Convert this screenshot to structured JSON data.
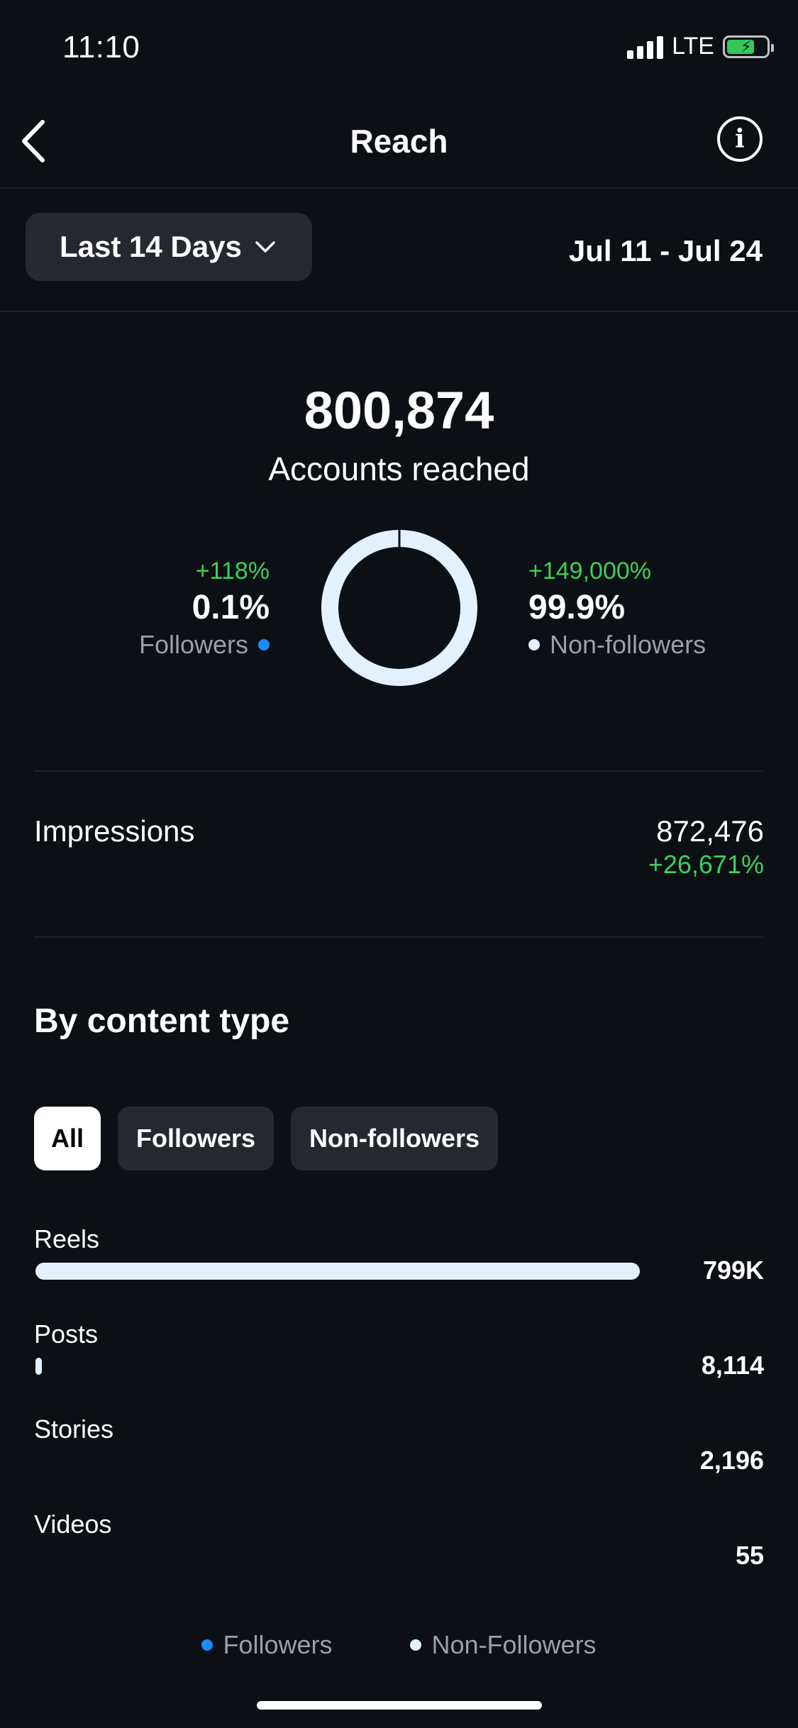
{
  "status_bar": {
    "time": "11:10",
    "network": "LTE"
  },
  "header": {
    "title": "Reach"
  },
  "date_range": {
    "selector_label": "Last 14 Days",
    "dates": "Jul 11 - Jul 24"
  },
  "summary": {
    "total": "800,874",
    "total_label": "Accounts reached",
    "followers": {
      "change": "+118%",
      "percent": "0.1%",
      "label": "Followers",
      "share": 0.001
    },
    "non_followers": {
      "change": "+149,000%",
      "percent": "99.9%",
      "label": "Non-followers",
      "share": 0.999
    }
  },
  "impressions": {
    "label": "Impressions",
    "value": "872,476",
    "change": "+26,671%"
  },
  "by_content_type": {
    "title": "By content type",
    "filters": [
      {
        "label": "All",
        "active": true
      },
      {
        "label": "Followers",
        "active": false
      },
      {
        "label": "Non-followers",
        "active": false
      }
    ],
    "rows": [
      {
        "label": "Reels",
        "value": "799K",
        "fraction": 1.0
      },
      {
        "label": "Posts",
        "value": "8,114",
        "fraction": 0.0102
      },
      {
        "label": "Stories",
        "value": "2,196",
        "fraction": 0.0027
      },
      {
        "label": "Videos",
        "value": "55",
        "fraction": 0.0001
      }
    ],
    "legend": {
      "followers": "Followers",
      "non_followers": "Non-Followers"
    }
  },
  "colors": {
    "followers": "#1a8cff",
    "non_followers": "#e3f1ff",
    "positive": "#3ccf5d",
    "background": "#0c0f14"
  }
}
